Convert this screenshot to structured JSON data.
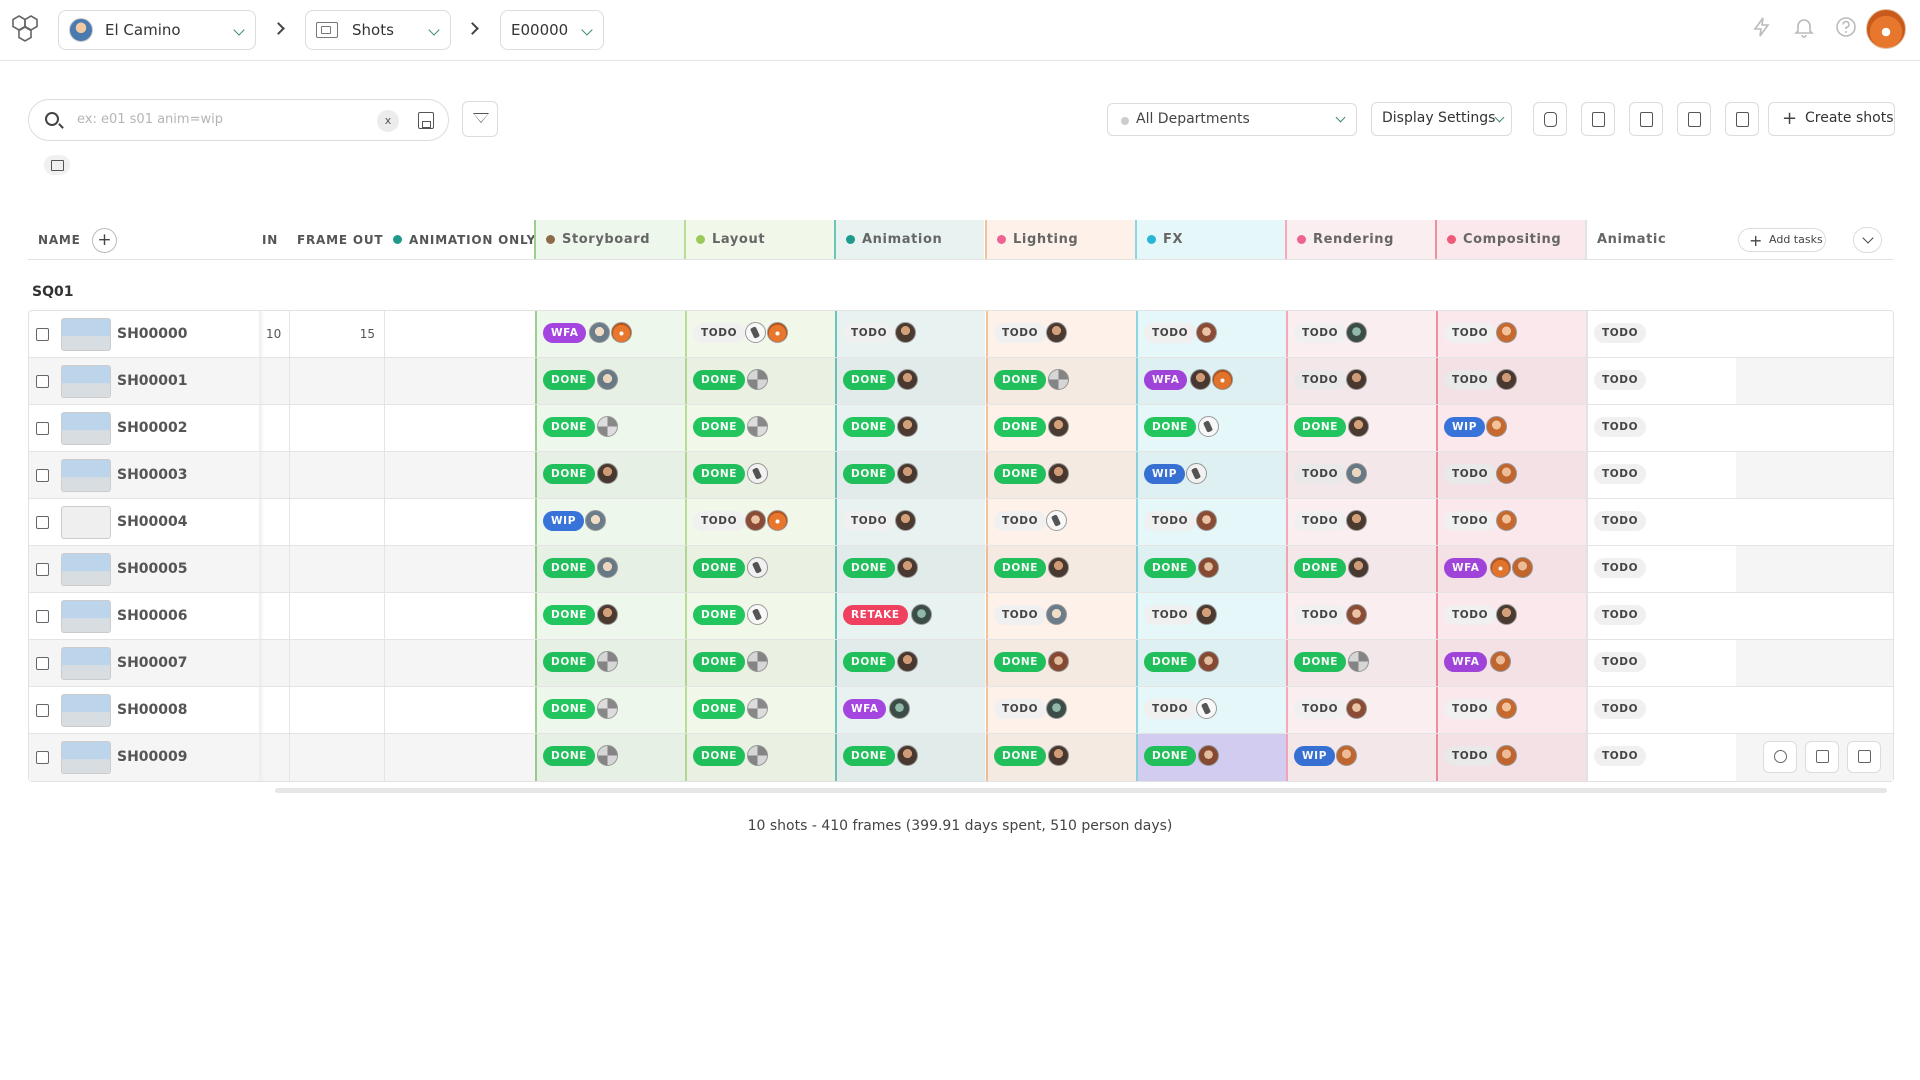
{
  "header": {
    "production": "El Camino",
    "section": "Shots",
    "episode": "E00000"
  },
  "toolbar": {
    "search_placeholder": "ex: e01 s01 anim=wip",
    "clear_label": "x",
    "department_select": "All Departments",
    "display_settings": "Display Settings",
    "create_shots": "Create shots"
  },
  "columns": {
    "name": "NAME",
    "frame_in": "IN",
    "frame_out": "FRAME OUT",
    "animation_only": "ANIMATION ONLY",
    "add_tasks": "Add tasks",
    "tasks": [
      {
        "label": "Storyboard",
        "color": "#8c6a4b"
      },
      {
        "label": "Layout",
        "color": "#9ac95a"
      },
      {
        "label": "Animation",
        "color": "#1f9a8a"
      },
      {
        "label": "Lighting",
        "color": "#f06292"
      },
      {
        "label": "FX",
        "color": "#29b6d6"
      },
      {
        "label": "Rendering",
        "color": "#f06292"
      },
      {
        "label": "Compositing",
        "color": "#ef5a78"
      },
      {
        "label": "Animatic",
        "color": ""
      }
    ]
  },
  "sequence": "SQ01",
  "shots": [
    {
      "name": "SH00000",
      "in": "10",
      "out": "15",
      "tasks": [
        [
          "WFA",
          "a2",
          "a3"
        ],
        [
          "TODO",
          "a6",
          "a3"
        ],
        [
          "TODO",
          "a1"
        ],
        [
          "TODO",
          "a1"
        ],
        [
          "TODO",
          "a5"
        ],
        [
          "TODO",
          "a7"
        ],
        [
          "TODO",
          "a8"
        ],
        [
          "TODO"
        ]
      ]
    },
    {
      "name": "SH00001",
      "in": "",
      "out": "",
      "tasks": [
        [
          "DONE",
          "a2"
        ],
        [
          "DONE",
          "a4"
        ],
        [
          "DONE",
          "a1"
        ],
        [
          "DONE",
          "a4"
        ],
        [
          "WFA",
          "a1",
          "a3"
        ],
        [
          "TODO",
          "a1"
        ],
        [
          "TODO",
          "a1"
        ],
        [
          "TODO"
        ]
      ]
    },
    {
      "name": "SH00002",
      "in": "",
      "out": "",
      "tasks": [
        [
          "DONE",
          "a4"
        ],
        [
          "DONE",
          "a4"
        ],
        [
          "DONE",
          "a1"
        ],
        [
          "DONE",
          "a1"
        ],
        [
          "DONE",
          "a6"
        ],
        [
          "DONE",
          "a1"
        ],
        [
          "WIP",
          "a8"
        ],
        [
          "TODO"
        ]
      ]
    },
    {
      "name": "SH00003",
      "in": "",
      "out": "",
      "tasks": [
        [
          "DONE",
          "a1"
        ],
        [
          "DONE",
          "a6"
        ],
        [
          "DONE",
          "a1"
        ],
        [
          "DONE",
          "a1"
        ],
        [
          "WIP",
          "a6"
        ],
        [
          "TODO",
          "a2"
        ],
        [
          "TODO",
          "a8"
        ],
        [
          "TODO"
        ]
      ]
    },
    {
      "name": "SH00004",
      "in": "",
      "out": "",
      "tasks": [
        [
          "WIP",
          "a2"
        ],
        [
          "TODO",
          "a5",
          "a3"
        ],
        [
          "TODO",
          "a1"
        ],
        [
          "TODO",
          "a6"
        ],
        [
          "TODO",
          "a5"
        ],
        [
          "TODO",
          "a1"
        ],
        [
          "TODO",
          "a8"
        ],
        [
          "TODO"
        ]
      ]
    },
    {
      "name": "SH00005",
      "in": "",
      "out": "",
      "tasks": [
        [
          "DONE",
          "a2"
        ],
        [
          "DONE",
          "a6"
        ],
        [
          "DONE",
          "a1"
        ],
        [
          "DONE",
          "a1"
        ],
        [
          "DONE",
          "a5"
        ],
        [
          "DONE",
          "a1"
        ],
        [
          "WFA",
          "a3",
          "a8"
        ],
        [
          "TODO"
        ]
      ]
    },
    {
      "name": "SH00006",
      "in": "",
      "out": "",
      "tasks": [
        [
          "DONE",
          "a1"
        ],
        [
          "DONE",
          "a6"
        ],
        [
          "RETAKE",
          "a7"
        ],
        [
          "TODO",
          "a2"
        ],
        [
          "TODO",
          "a1"
        ],
        [
          "TODO",
          "a5"
        ],
        [
          "TODO",
          "a1"
        ],
        [
          "TODO"
        ]
      ]
    },
    {
      "name": "SH00007",
      "in": "",
      "out": "",
      "tasks": [
        [
          "DONE",
          "a4"
        ],
        [
          "DONE",
          "a4"
        ],
        [
          "DONE",
          "a1"
        ],
        [
          "DONE",
          "a5"
        ],
        [
          "DONE",
          "a5"
        ],
        [
          "DONE",
          "a4"
        ],
        [
          "WFA",
          "a8"
        ],
        [
          "TODO"
        ]
      ]
    },
    {
      "name": "SH00008",
      "in": "",
      "out": "",
      "tasks": [
        [
          "DONE",
          "a4"
        ],
        [
          "DONE",
          "a4"
        ],
        [
          "WFA",
          "a7"
        ],
        [
          "TODO",
          "a7"
        ],
        [
          "TODO",
          "a6"
        ],
        [
          "TODO",
          "a5"
        ],
        [
          "TODO",
          "a8"
        ],
        [
          "TODO"
        ]
      ]
    },
    {
      "name": "SH00009",
      "in": "",
      "out": "",
      "tasks": [
        [
          "DONE",
          "a4"
        ],
        [
          "DONE",
          "a4"
        ],
        [
          "DONE",
          "a1"
        ],
        [
          "DONE",
          "a1"
        ],
        [
          "DONE",
          "a5"
        ],
        [
          "WIP",
          "a8"
        ],
        [
          "TODO",
          "a8"
        ],
        [
          "TODO"
        ]
      ]
    }
  ],
  "summary": "10 shots - 410 frames (399.91 days spent, 510 person days)"
}
